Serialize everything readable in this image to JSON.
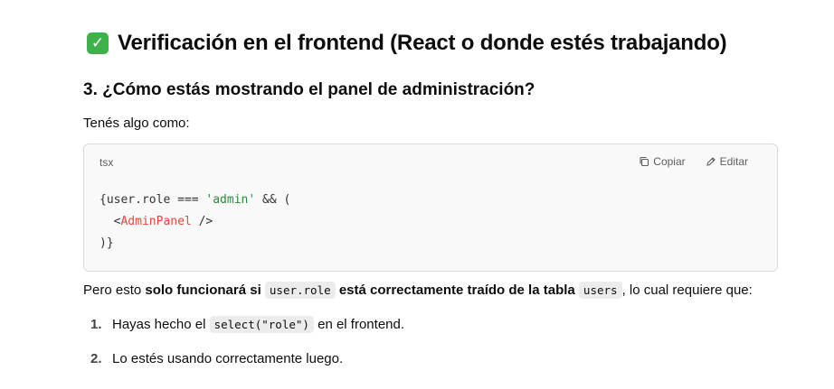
{
  "heading": {
    "icon": "check-box-icon",
    "text": "Verificación en el frontend (React o donde estés trabajando)"
  },
  "subheading": "3. ¿Cómo estás mostrando el panel de administración?",
  "intro": "Tenés algo como:",
  "code_block": {
    "language": "tsx",
    "copy_label": "Copiar",
    "edit_label": "Editar",
    "line1_pre": "{user.role === ",
    "line1_str": "'admin'",
    "line1_post": " && (",
    "line2_pre": "  <",
    "line2_tag": "AdminPanel",
    "line2_post": " />",
    "line3": ")}"
  },
  "paragraph": {
    "t1": "Pero esto ",
    "b1": "solo funcionará si",
    "c1": "user.role",
    "b2": "está correctamente traído de la tabla",
    "c2": "users",
    "t2": ", lo cual requiere que:"
  },
  "list": {
    "item1_num": "1.",
    "item1_pre": "Hayas hecho el ",
    "item1_code": "select(\"role\")",
    "item1_post": " en el frontend.",
    "item2_num": "2.",
    "item2_text": "Lo estés usando correctamente luego."
  }
}
